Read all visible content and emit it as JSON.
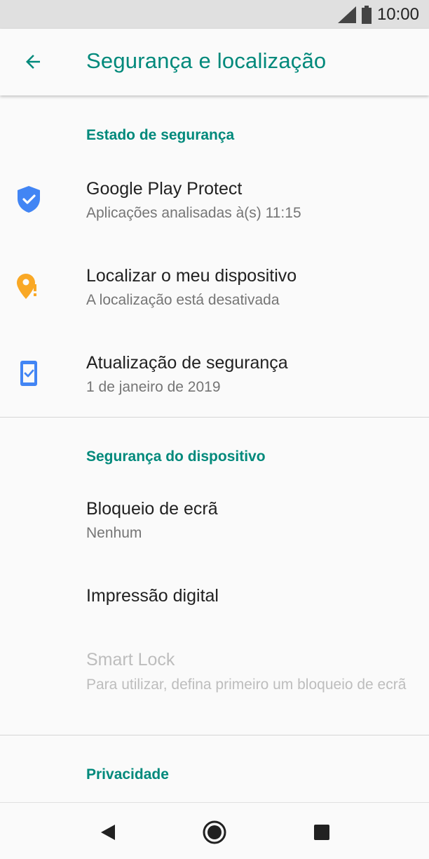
{
  "status_bar": {
    "time": "10:00",
    "icons": [
      "signal-icon",
      "battery-icon"
    ]
  },
  "app_bar": {
    "back_icon": "arrow-back-icon",
    "title": "Segurança e localização"
  },
  "sections": {
    "security_status": {
      "header": "Estado de segurança",
      "items": [
        {
          "icon": "shield-check-icon",
          "title": "Google Play Protect",
          "subtitle": "Aplicações analisadas à(s) 11:15"
        },
        {
          "icon": "location-alert-icon",
          "title": "Localizar o meu dispositivo",
          "subtitle": "A localização está desativada"
        },
        {
          "icon": "phone-check-icon",
          "title": "Atualização de segurança",
          "subtitle": "1 de janeiro de 2019"
        }
      ]
    },
    "device_security": {
      "header": "Segurança do dispositivo",
      "items": [
        {
          "title": "Bloqueio de ecrã",
          "subtitle": "Nenhum"
        },
        {
          "title": "Impressão digital"
        },
        {
          "title": "Smart Lock",
          "subtitle": "Para utilizar, defina primeiro um bloqueio de ecrã",
          "disabled": true
        }
      ]
    },
    "privacy": {
      "header": "Privacidade"
    }
  },
  "nav_bar": {
    "icons": [
      "back-triangle-icon",
      "home-circle-icon",
      "recents-square-icon"
    ]
  },
  "colors": {
    "accent": "#00897b",
    "shield_blue": "#4285f4",
    "location_orange": "#f9a825",
    "disabled_text": "#bdbdbd"
  }
}
